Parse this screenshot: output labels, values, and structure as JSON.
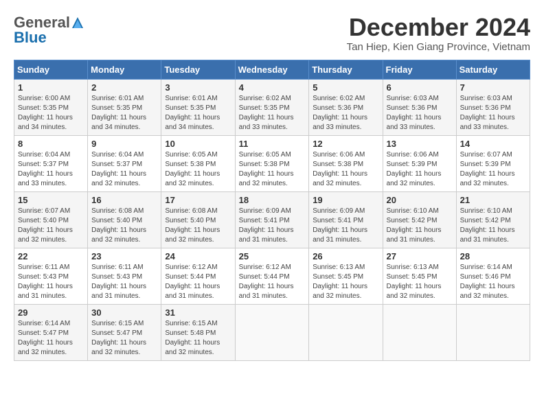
{
  "header": {
    "logo": {
      "general": "General",
      "blue": "Blue"
    },
    "title": "December 2024",
    "subtitle": "Tan Hiep, Kien Giang Province, Vietnam"
  },
  "weekdays": [
    "Sunday",
    "Monday",
    "Tuesday",
    "Wednesday",
    "Thursday",
    "Friday",
    "Saturday"
  ],
  "weeks": [
    [
      {
        "day": "1",
        "sunrise": "Sunrise: 6:00 AM",
        "sunset": "Sunset: 5:35 PM",
        "daylight": "Daylight: 11 hours and 34 minutes."
      },
      {
        "day": "2",
        "sunrise": "Sunrise: 6:01 AM",
        "sunset": "Sunset: 5:35 PM",
        "daylight": "Daylight: 11 hours and 34 minutes."
      },
      {
        "day": "3",
        "sunrise": "Sunrise: 6:01 AM",
        "sunset": "Sunset: 5:35 PM",
        "daylight": "Daylight: 11 hours and 34 minutes."
      },
      {
        "day": "4",
        "sunrise": "Sunrise: 6:02 AM",
        "sunset": "Sunset: 5:35 PM",
        "daylight": "Daylight: 11 hours and 33 minutes."
      },
      {
        "day": "5",
        "sunrise": "Sunrise: 6:02 AM",
        "sunset": "Sunset: 5:36 PM",
        "daylight": "Daylight: 11 hours and 33 minutes."
      },
      {
        "day": "6",
        "sunrise": "Sunrise: 6:03 AM",
        "sunset": "Sunset: 5:36 PM",
        "daylight": "Daylight: 11 hours and 33 minutes."
      },
      {
        "day": "7",
        "sunrise": "Sunrise: 6:03 AM",
        "sunset": "Sunset: 5:36 PM",
        "daylight": "Daylight: 11 hours and 33 minutes."
      }
    ],
    [
      {
        "day": "8",
        "sunrise": "Sunrise: 6:04 AM",
        "sunset": "Sunset: 5:37 PM",
        "daylight": "Daylight: 11 hours and 33 minutes."
      },
      {
        "day": "9",
        "sunrise": "Sunrise: 6:04 AM",
        "sunset": "Sunset: 5:37 PM",
        "daylight": "Daylight: 11 hours and 32 minutes."
      },
      {
        "day": "10",
        "sunrise": "Sunrise: 6:05 AM",
        "sunset": "Sunset: 5:38 PM",
        "daylight": "Daylight: 11 hours and 32 minutes."
      },
      {
        "day": "11",
        "sunrise": "Sunrise: 6:05 AM",
        "sunset": "Sunset: 5:38 PM",
        "daylight": "Daylight: 11 hours and 32 minutes."
      },
      {
        "day": "12",
        "sunrise": "Sunrise: 6:06 AM",
        "sunset": "Sunset: 5:38 PM",
        "daylight": "Daylight: 11 hours and 32 minutes."
      },
      {
        "day": "13",
        "sunrise": "Sunrise: 6:06 AM",
        "sunset": "Sunset: 5:39 PM",
        "daylight": "Daylight: 11 hours and 32 minutes."
      },
      {
        "day": "14",
        "sunrise": "Sunrise: 6:07 AM",
        "sunset": "Sunset: 5:39 PM",
        "daylight": "Daylight: 11 hours and 32 minutes."
      }
    ],
    [
      {
        "day": "15",
        "sunrise": "Sunrise: 6:07 AM",
        "sunset": "Sunset: 5:40 PM",
        "daylight": "Daylight: 11 hours and 32 minutes."
      },
      {
        "day": "16",
        "sunrise": "Sunrise: 6:08 AM",
        "sunset": "Sunset: 5:40 PM",
        "daylight": "Daylight: 11 hours and 32 minutes."
      },
      {
        "day": "17",
        "sunrise": "Sunrise: 6:08 AM",
        "sunset": "Sunset: 5:40 PM",
        "daylight": "Daylight: 11 hours and 32 minutes."
      },
      {
        "day": "18",
        "sunrise": "Sunrise: 6:09 AM",
        "sunset": "Sunset: 5:41 PM",
        "daylight": "Daylight: 11 hours and 31 minutes."
      },
      {
        "day": "19",
        "sunrise": "Sunrise: 6:09 AM",
        "sunset": "Sunset: 5:41 PM",
        "daylight": "Daylight: 11 hours and 31 minutes."
      },
      {
        "day": "20",
        "sunrise": "Sunrise: 6:10 AM",
        "sunset": "Sunset: 5:42 PM",
        "daylight": "Daylight: 11 hours and 31 minutes."
      },
      {
        "day": "21",
        "sunrise": "Sunrise: 6:10 AM",
        "sunset": "Sunset: 5:42 PM",
        "daylight": "Daylight: 11 hours and 31 minutes."
      }
    ],
    [
      {
        "day": "22",
        "sunrise": "Sunrise: 6:11 AM",
        "sunset": "Sunset: 5:43 PM",
        "daylight": "Daylight: 11 hours and 31 minutes."
      },
      {
        "day": "23",
        "sunrise": "Sunrise: 6:11 AM",
        "sunset": "Sunset: 5:43 PM",
        "daylight": "Daylight: 11 hours and 31 minutes."
      },
      {
        "day": "24",
        "sunrise": "Sunrise: 6:12 AM",
        "sunset": "Sunset: 5:44 PM",
        "daylight": "Daylight: 11 hours and 31 minutes."
      },
      {
        "day": "25",
        "sunrise": "Sunrise: 6:12 AM",
        "sunset": "Sunset: 5:44 PM",
        "daylight": "Daylight: 11 hours and 31 minutes."
      },
      {
        "day": "26",
        "sunrise": "Sunrise: 6:13 AM",
        "sunset": "Sunset: 5:45 PM",
        "daylight": "Daylight: 11 hours and 32 minutes."
      },
      {
        "day": "27",
        "sunrise": "Sunrise: 6:13 AM",
        "sunset": "Sunset: 5:45 PM",
        "daylight": "Daylight: 11 hours and 32 minutes."
      },
      {
        "day": "28",
        "sunrise": "Sunrise: 6:14 AM",
        "sunset": "Sunset: 5:46 PM",
        "daylight": "Daylight: 11 hours and 32 minutes."
      }
    ],
    [
      {
        "day": "29",
        "sunrise": "Sunrise: 6:14 AM",
        "sunset": "Sunset: 5:47 PM",
        "daylight": "Daylight: 11 hours and 32 minutes."
      },
      {
        "day": "30",
        "sunrise": "Sunrise: 6:15 AM",
        "sunset": "Sunset: 5:47 PM",
        "daylight": "Daylight: 11 hours and 32 minutes."
      },
      {
        "day": "31",
        "sunrise": "Sunrise: 6:15 AM",
        "sunset": "Sunset: 5:48 PM",
        "daylight": "Daylight: 11 hours and 32 minutes."
      },
      null,
      null,
      null,
      null
    ]
  ]
}
